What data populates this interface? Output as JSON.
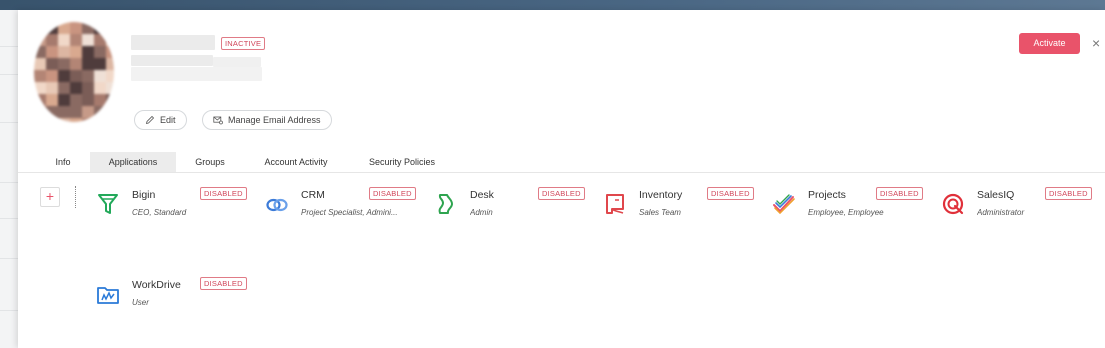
{
  "user": {
    "status": "INACTIVE"
  },
  "header": {
    "activate_label": "Activate",
    "close_icon": "×"
  },
  "actions": {
    "edit_label": "Edit",
    "manage_email_label": "Manage Email Address"
  },
  "tabs": [
    {
      "label": "Info"
    },
    {
      "label": "Applications",
      "active": true
    },
    {
      "label": "Groups"
    },
    {
      "label": "Account Activity"
    },
    {
      "label": "Security Policies"
    }
  ],
  "add_button_label": "+",
  "apps": [
    {
      "name": "Bigin",
      "role": "CEO, Standard",
      "status": "DISABLED",
      "icon": "bigin-icon",
      "color": "#22a95a"
    },
    {
      "name": "CRM",
      "role": "Project Specialist, Admini...",
      "status": "DISABLED",
      "icon": "crm-icon",
      "color": "#3c7bd8"
    },
    {
      "name": "Desk",
      "role": "Admin",
      "status": "DISABLED",
      "icon": "desk-icon",
      "color": "#2ea44f"
    },
    {
      "name": "Inventory",
      "role": "Sales Team",
      "status": "DISABLED",
      "icon": "inventory-icon",
      "color": "#e0474c"
    },
    {
      "name": "Projects",
      "role": "Employee, Employee",
      "status": "DISABLED",
      "icon": "projects-icon",
      "color": "#e9536a"
    },
    {
      "name": "SalesIQ",
      "role": "Administrator",
      "status": "DISABLED",
      "icon": "salesiq-icon",
      "color": "#e0303a"
    },
    {
      "name": "WorkDrive",
      "role": "User",
      "status": "DISABLED",
      "icon": "workdrive-icon",
      "color": "#2a7ad8"
    }
  ],
  "colors": {
    "accent": "#e9536a",
    "header_bar": "#3f5a74",
    "tab_active_bg": "#ececec"
  }
}
